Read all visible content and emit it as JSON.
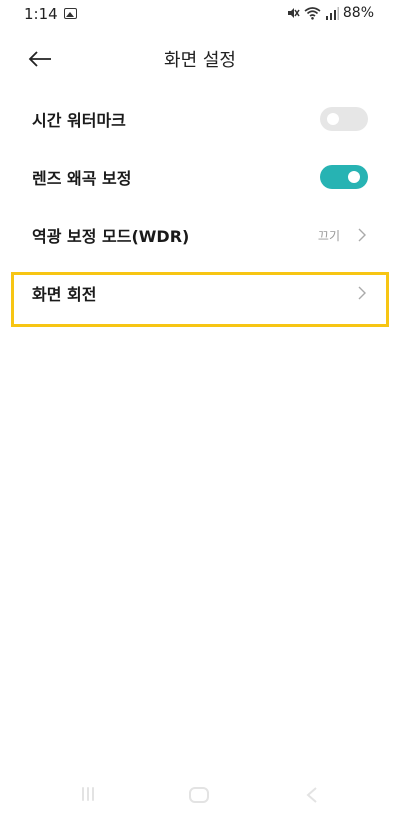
{
  "status_bar": {
    "time": "1:14",
    "battery": "88%",
    "icons": [
      "gallery-icon",
      "mute-icon",
      "wifi-icon",
      "signal-icon"
    ]
  },
  "header": {
    "title": "화면 설정",
    "back_icon": "back-arrow-icon"
  },
  "settings": [
    {
      "label": "시간 워터마크",
      "control": "toggle",
      "checked": false
    },
    {
      "label": "렌즈 왜곡 보정",
      "control": "toggle",
      "checked": true
    },
    {
      "label": "역광 보정 모드(WDR)",
      "control": "chevron",
      "value": "끄기"
    },
    {
      "label": "화면 회전",
      "control": "chevron",
      "highlighted": true
    }
  ],
  "colors": {
    "toggle_on": "#27b3b3",
    "toggle_off": "#e6e6e6",
    "highlight": "#f7c513"
  },
  "nav_bar": {
    "icons": [
      "recents-icon",
      "home-icon",
      "back-icon"
    ]
  }
}
